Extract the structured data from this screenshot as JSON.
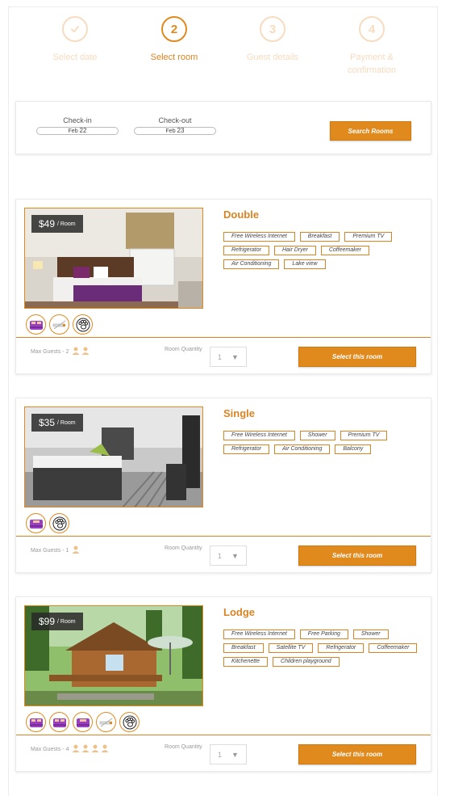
{
  "steps": [
    {
      "num": "",
      "label": "Select date",
      "state": "done",
      "icon": "check-icon"
    },
    {
      "num": "2",
      "label": "Select room",
      "state": "active"
    },
    {
      "num": "3",
      "label": "Guest details",
      "state": "pending"
    },
    {
      "num": "4",
      "label": "Payment & confirmation",
      "state": "pending"
    }
  ],
  "search": {
    "checkin_label": "Check-in",
    "checkin_month": "Feb",
    "checkin_day": "22",
    "checkout_label": "Check-out",
    "checkout_month": "Feb",
    "checkout_day": "23",
    "button": "Search Rooms"
  },
  "rooms": [
    {
      "name": "Double",
      "price": "$49",
      "unit": "/ Room",
      "amenities": [
        "Free Wireless Internet",
        "Breakfast",
        "Premium TV",
        "Refrigerator",
        "Hair Dryer",
        "Coffeemaker",
        "Air Conditioning",
        "Lake view"
      ],
      "icons": [
        "double-bed-icon",
        "no-smoking-icon",
        "pet-friendly-icon"
      ],
      "max_guests": "Max Guests - 2",
      "guests": 2,
      "qty_label": "Room Quantity",
      "qty": "1",
      "button": "Select this room"
    },
    {
      "name": "Single",
      "price": "$35",
      "unit": "/ Room",
      "amenities": [
        "Free Wireless Internet",
        "Shower",
        "Premium TV",
        "Refrigerator",
        "Air Conditioning",
        "Balcony"
      ],
      "icons": [
        "single-bed-icon",
        "pet-friendly-icon"
      ],
      "max_guests": "Max Guests - 1",
      "guests": 1,
      "qty_label": "Room Quantity",
      "qty": "1",
      "button": "Select this room"
    },
    {
      "name": "Lodge",
      "price": "$99",
      "unit": "/ Room",
      "amenities": [
        "Free Wireless Internet",
        "Free Parking",
        "Shower",
        "Breakfast",
        "Satellite TV",
        "Refrigerator",
        "Coffeemaker",
        "Kitchenette",
        "Children playground"
      ],
      "icons": [
        "double-bed-icon",
        "double-bed-icon",
        "single-bed-icon",
        "no-smoking-icon",
        "pet-friendly-icon"
      ],
      "max_guests": "Max Guests - 4",
      "guests": 4,
      "qty_label": "Room Quantity",
      "qty": "1",
      "button": "Select this room"
    }
  ],
  "colors": {
    "accent": "#e08a1e",
    "accent_light": "#f7dcc0",
    "bed_purple": "#9b3fc2"
  }
}
